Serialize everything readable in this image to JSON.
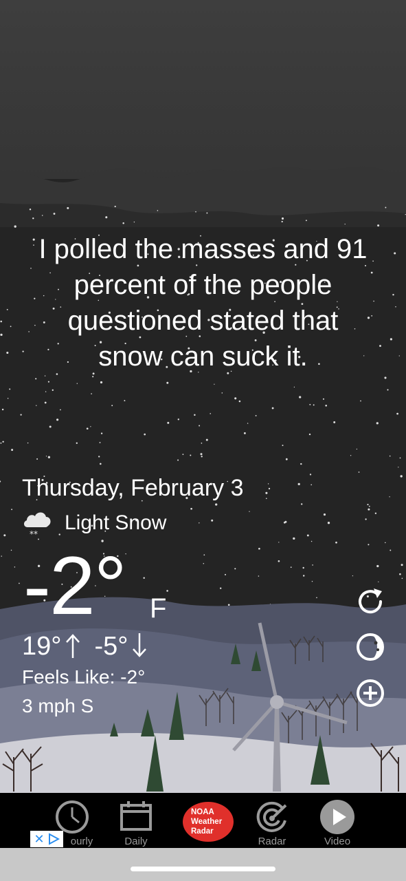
{
  "quote": {
    "lines": [
      "I polled the masses and 91",
      "percent of the people",
      "questioned stated that",
      "snow can suck it."
    ]
  },
  "weather": {
    "date": "Thursday, February 3",
    "condition": "Light Snow",
    "condition_icon": "snow-cloud-icon",
    "temperature": "-2°",
    "unit": "F",
    "high": "19°",
    "low": "-5°",
    "feels_like": "Feels Like: -2°",
    "wind": "3 mph S"
  },
  "side_actions": [
    {
      "icon": "refresh-icon"
    },
    {
      "icon": "moon-phase-icon"
    },
    {
      "icon": "add-icon"
    }
  ],
  "tabs": {
    "hourly": "ourly",
    "daily": "Daily",
    "noaa": [
      "NOAA",
      "Weather",
      "Radar"
    ],
    "radar": "Radar",
    "video": "Video"
  },
  "colors": {
    "noaa_red": "#e0302b",
    "tab_label": "#9a9a9a",
    "sky": "#242424"
  }
}
